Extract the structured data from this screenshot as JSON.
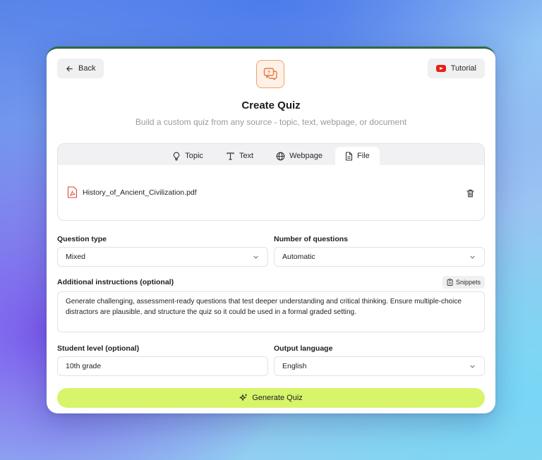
{
  "header": {
    "back_label": "Back",
    "tutorial_label": "Tutorial",
    "title": "Create Quiz",
    "subtitle": "Build a custom quiz from any source - topic, text, webpage, or document"
  },
  "source_tabs": {
    "items": [
      {
        "label": "Topic",
        "icon": "lightbulb-icon"
      },
      {
        "label": "Text",
        "icon": "text-icon"
      },
      {
        "label": "Webpage",
        "icon": "globe-icon"
      },
      {
        "label": "File",
        "icon": "file-icon"
      }
    ],
    "active": "File"
  },
  "file": {
    "name": "History_of_Ancient_Civilization.pdf"
  },
  "form": {
    "question_type_label": "Question type",
    "question_type_value": "Mixed",
    "num_questions_label": "Number of questions",
    "num_questions_value": "Automatic",
    "instructions_label": "Additional instructions (optional)",
    "snippets_label": "Snippets",
    "instructions_value": "Generate challenging, assessment-ready questions that test deeper understanding and critical thinking. Ensure multiple-choice distractors are plausible, and structure the quiz so it could be used in a formal graded setting.",
    "student_level_label": "Student level (optional)",
    "student_level_value": "10th grade",
    "output_language_label": "Output language",
    "output_language_value": "English"
  },
  "generate_label": "Generate Quiz",
  "colors": {
    "accent": "#d8f46a",
    "logo_orange": "#f2a06a",
    "youtube_red": "#e62117",
    "pdf_red": "#e0453a"
  }
}
